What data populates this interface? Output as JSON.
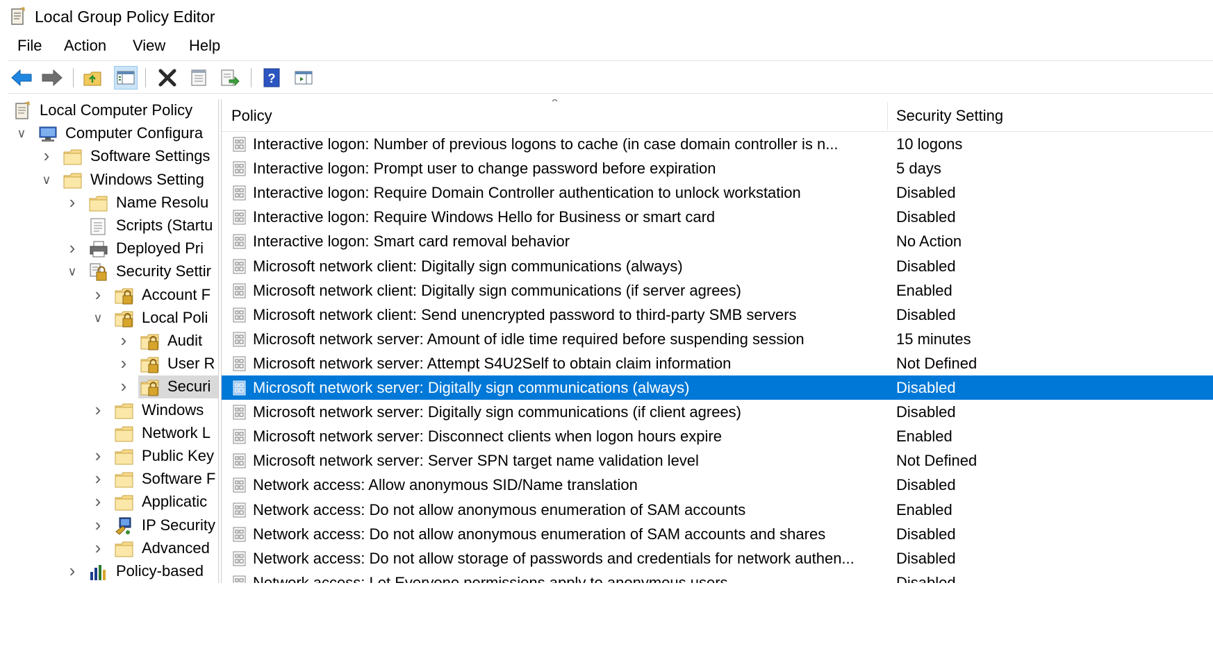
{
  "window": {
    "title": "Local Group Policy Editor",
    "icon": "policy-document-icon"
  },
  "menu": [
    "File",
    "Action",
    "View",
    "Help"
  ],
  "toolbar": {
    "buttons": [
      "back-arrow-icon",
      "forward-arrow-icon",
      "up-folder-icon",
      "show-hide-tree-icon",
      "delete-icon",
      "properties-icon",
      "export-list-icon",
      "help-icon",
      "show-hide-action-pane-icon"
    ]
  },
  "tree": {
    "items": [
      {
        "label": "Local Computer Policy",
        "icon": "policy-document-icon",
        "expander": ""
      },
      {
        "label": "Computer Configura",
        "icon": "computer-icon",
        "expander": "expanded"
      },
      {
        "label": "Software Settings",
        "icon": "folder-icon",
        "expander": "collapsed"
      },
      {
        "label": "Windows Setting",
        "icon": "folder-icon",
        "expander": "expanded"
      },
      {
        "label": "Name Resolu",
        "icon": "folder-icon",
        "expander": "collapsed"
      },
      {
        "label": "Scripts (Startu",
        "icon": "scripts-icon",
        "expander": ""
      },
      {
        "label": "Deployed Pri",
        "icon": "printer-icon",
        "expander": "collapsed"
      },
      {
        "label": "Security Settir",
        "icon": "security-settings-icon",
        "expander": "expanded"
      },
      {
        "label": "Account F",
        "icon": "locked-folder-icon",
        "expander": "collapsed"
      },
      {
        "label": "Local Poli",
        "icon": "locked-folder-icon",
        "expander": "expanded"
      },
      {
        "label": "Audit",
        "icon": "locked-folder-icon",
        "expander": "collapsed"
      },
      {
        "label": "User R",
        "icon": "locked-folder-icon",
        "expander": "collapsed"
      },
      {
        "label": "Securi",
        "icon": "locked-folder-icon",
        "expander": "collapsed",
        "selected": true
      },
      {
        "label": "Windows",
        "icon": "folder-icon",
        "expander": "collapsed"
      },
      {
        "label": "Network L",
        "icon": "folder-icon",
        "expander": ""
      },
      {
        "label": "Public Key",
        "icon": "folder-icon",
        "expander": "collapsed"
      },
      {
        "label": "Software F",
        "icon": "folder-icon",
        "expander": "collapsed"
      },
      {
        "label": "Applicatic",
        "icon": "folder-icon",
        "expander": "collapsed"
      },
      {
        "label": "IP Security",
        "icon": "ip-security-icon",
        "expander": "collapsed"
      },
      {
        "label": "Advanced",
        "icon": "folder-icon",
        "expander": "collapsed"
      },
      {
        "label": "Policy-based",
        "icon": "bar-chart-icon",
        "expander": "collapsed"
      }
    ]
  },
  "list": {
    "columns": {
      "policy": "Policy",
      "setting": "Security Setting"
    },
    "rows": [
      {
        "policy": "Interactive logon: Number of previous logons to cache (in case domain controller is n...",
        "setting": "10 logons"
      },
      {
        "policy": "Interactive logon: Prompt user to change password before expiration",
        "setting": "5 days"
      },
      {
        "policy": "Interactive logon: Require Domain Controller authentication to unlock workstation",
        "setting": "Disabled"
      },
      {
        "policy": "Interactive logon: Require Windows Hello for Business or smart card",
        "setting": "Disabled"
      },
      {
        "policy": "Interactive logon: Smart card removal behavior",
        "setting": "No Action"
      },
      {
        "policy": "Microsoft network client: Digitally sign communications (always)",
        "setting": "Disabled"
      },
      {
        "policy": "Microsoft network client: Digitally sign communications (if server agrees)",
        "setting": "Enabled"
      },
      {
        "policy": "Microsoft network client: Send unencrypted password to third-party SMB servers",
        "setting": "Disabled"
      },
      {
        "policy": "Microsoft network server: Amount of idle time required before suspending session",
        "setting": "15 minutes"
      },
      {
        "policy": "Microsoft network server: Attempt S4U2Self to obtain claim information",
        "setting": "Not Defined"
      },
      {
        "policy": "Microsoft network server: Digitally sign communications (always)",
        "setting": "Disabled",
        "selected": true
      },
      {
        "policy": "Microsoft network server: Digitally sign communications (if client agrees)",
        "setting": "Disabled"
      },
      {
        "policy": "Microsoft network server: Disconnect clients when logon hours expire",
        "setting": "Enabled"
      },
      {
        "policy": "Microsoft network server: Server SPN target name validation level",
        "setting": "Not Defined"
      },
      {
        "policy": "Network access: Allow anonymous SID/Name translation",
        "setting": "Disabled"
      },
      {
        "policy": "Network access: Do not allow anonymous enumeration of SAM accounts",
        "setting": "Enabled"
      },
      {
        "policy": "Network access: Do not allow anonymous enumeration of SAM accounts and shares",
        "setting": "Disabled"
      },
      {
        "policy": "Network access: Do not allow storage of passwords and credentials for network authen...",
        "setting": "Disabled"
      },
      {
        "policy": "Network access: Let Everyone permissions apply to anonymous users",
        "setting": "Disabled"
      }
    ]
  },
  "colors": {
    "selection": "#0078d7",
    "tree_selection": "#d9d9d9",
    "folder": "#f4d47c",
    "lock": "#d7a52c"
  }
}
